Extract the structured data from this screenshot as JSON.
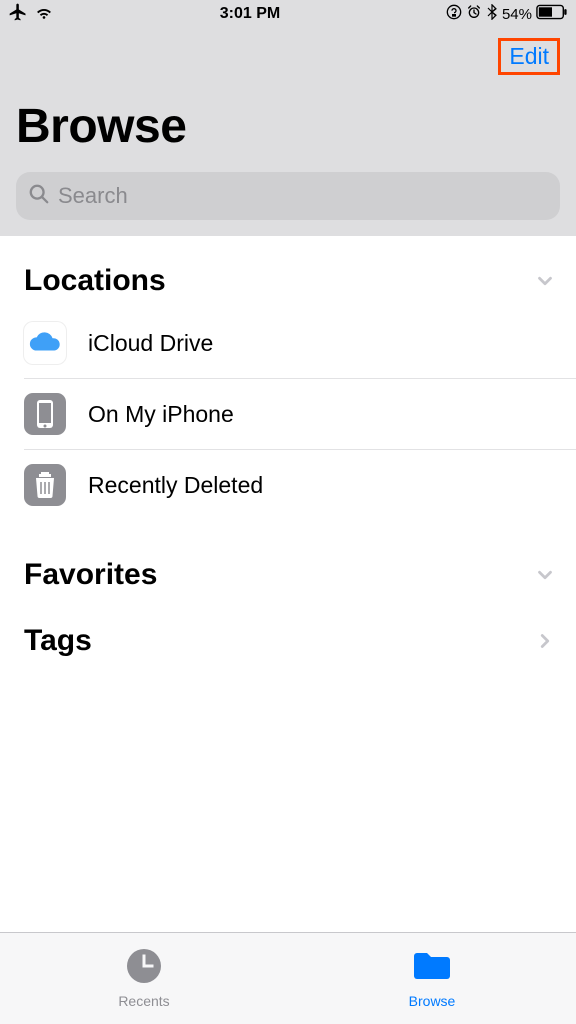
{
  "status": {
    "time": "3:01 PM",
    "battery_pct": "54%"
  },
  "header": {
    "edit": "Edit",
    "title": "Browse",
    "search_placeholder": "Search"
  },
  "sections": {
    "locations": {
      "title": "Locations",
      "items": [
        {
          "label": "iCloud Drive"
        },
        {
          "label": "On My iPhone"
        },
        {
          "label": "Recently Deleted"
        }
      ]
    },
    "favorites": {
      "title": "Favorites"
    },
    "tags": {
      "title": "Tags"
    }
  },
  "tabs": {
    "recents": "Recents",
    "browse": "Browse"
  }
}
